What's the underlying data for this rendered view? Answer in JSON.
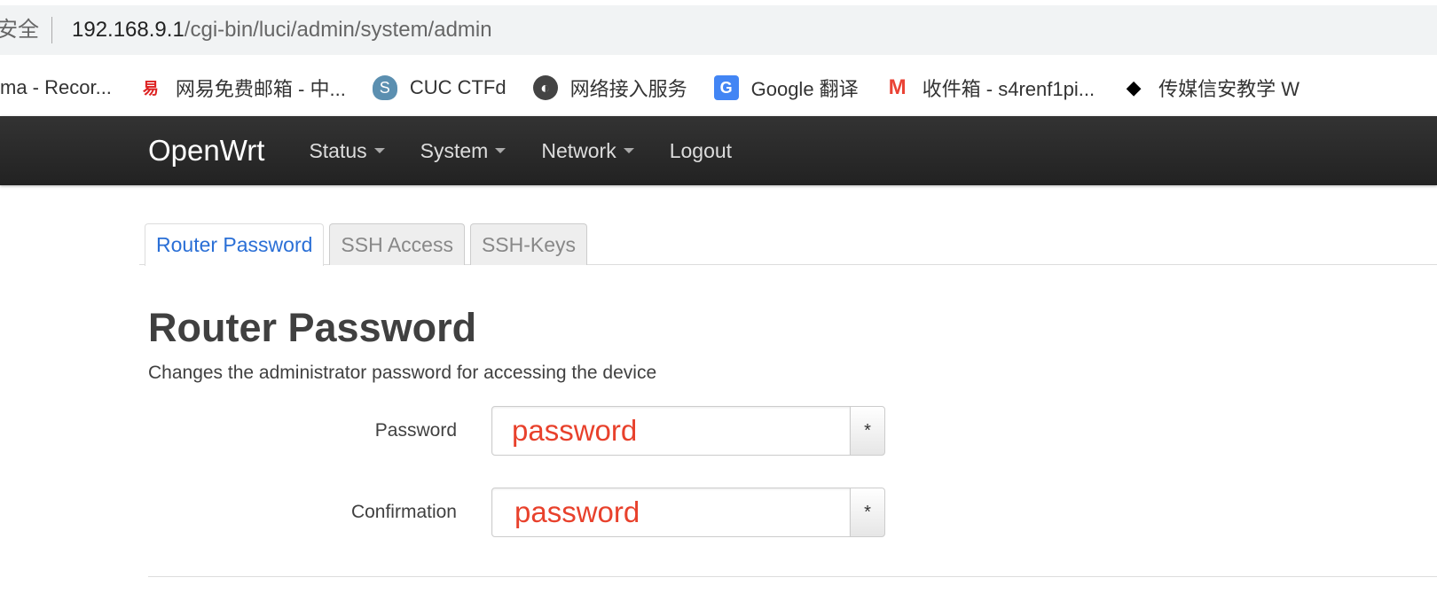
{
  "browser": {
    "security_label": "安全",
    "url_host": "192.168.9.1",
    "url_path": "/cgi-bin/luci/admin/system/admin",
    "bookmarks": [
      {
        "label": "ma - Recor...",
        "icon": "none"
      },
      {
        "label": "网易免费邮箱 - 中...",
        "icon": "netease-icon"
      },
      {
        "label": "CUC CTFd",
        "icon": "shield-icon"
      },
      {
        "label": "网络接入服务",
        "icon": "globe-icon"
      },
      {
        "label": "Google 翻译",
        "icon": "google-translate-icon"
      },
      {
        "label": "收件箱 - s4renf1pi...",
        "icon": "gmail-icon"
      },
      {
        "label": "传媒信安教学 W",
        "icon": "graduation-cap-icon"
      }
    ]
  },
  "nav": {
    "brand": "OpenWrt",
    "items": [
      "Status",
      "System",
      "Network",
      "Logout"
    ]
  },
  "tabs": [
    "Router Password",
    "SSH Access",
    "SSH-Keys"
  ],
  "main": {
    "title": "Router Password",
    "description": "Changes the administrator password for accessing the device",
    "fields": [
      {
        "label": "Password",
        "value": "password",
        "reveal": "*"
      },
      {
        "label": "Confirmation",
        "value": "password",
        "reveal": "*"
      }
    ]
  },
  "colors": {
    "accent": "#2a6fd6",
    "input_text": "#e8412c",
    "navbar": "#222222"
  }
}
